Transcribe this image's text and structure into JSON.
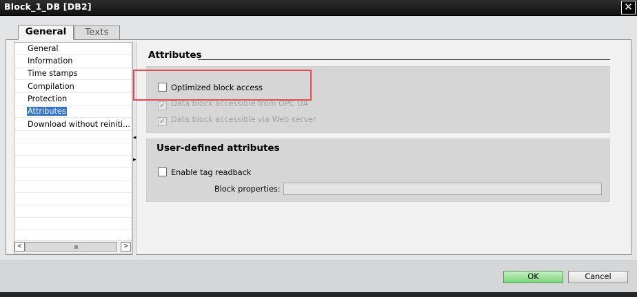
{
  "window": {
    "title": "Block_1_DB [DB2]",
    "close_glyph": "✕"
  },
  "tabs": [
    {
      "label": "General",
      "active": true
    },
    {
      "label": "Texts",
      "active": false
    }
  ],
  "nav": {
    "items": [
      {
        "label": "General",
        "selected": false
      },
      {
        "label": "Information",
        "selected": false
      },
      {
        "label": "Time stamps",
        "selected": false
      },
      {
        "label": "Compilation",
        "selected": false
      },
      {
        "label": "Protection",
        "selected": false
      },
      {
        "label": "Attributes",
        "selected": true
      },
      {
        "label": "Download without reiniti...",
        "selected": false
      }
    ],
    "scroll_left_glyph": "<",
    "scroll_right_glyph": ">"
  },
  "attributes": {
    "header": "Attributes",
    "optimized_block_access": {
      "label": "Optimized block access",
      "checked": false
    },
    "opc_ua": {
      "label": "Data block accessible from OPC UA",
      "checked": true,
      "enabled": false
    },
    "web_server": {
      "label": "Data block accessible via Web server",
      "checked": true,
      "enabled": false
    }
  },
  "user_defined": {
    "title": "User-defined attributes",
    "enable_tag_readback": {
      "label": "Enable tag readback",
      "checked": false
    },
    "block_properties_label": "Block properties:",
    "block_properties_value": ""
  },
  "buttons": {
    "ok": "OK",
    "cancel": "Cancel"
  },
  "colors": {
    "highlight": "#e64a4f",
    "ok_button": "#7ad47a",
    "selected_item": "#3275d4",
    "titlebar": "#1a1a1a"
  },
  "icons": {
    "check": "✔"
  }
}
